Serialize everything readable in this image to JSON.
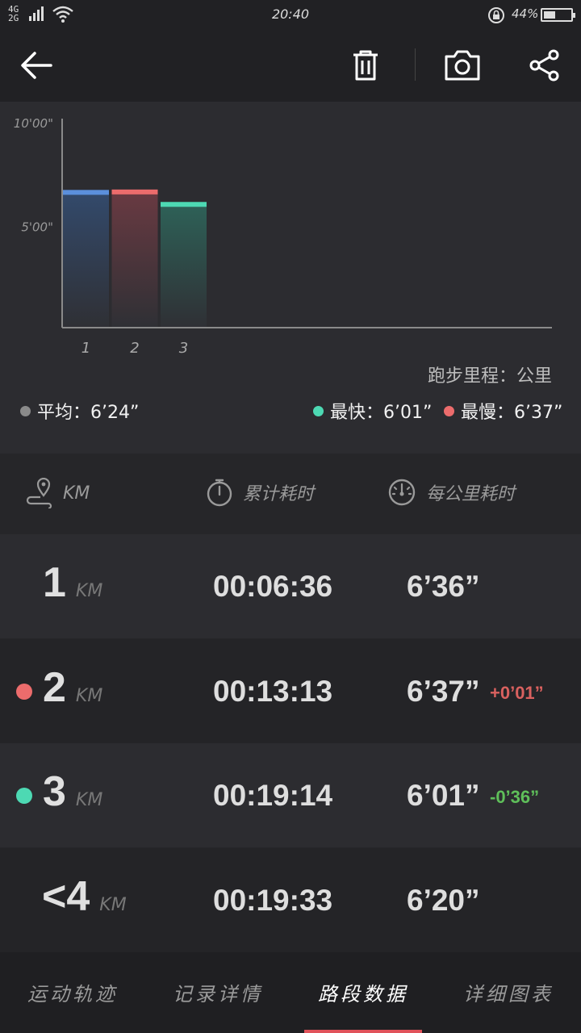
{
  "status_bar": {
    "network": [
      "4G",
      "2G"
    ],
    "time": "20:40",
    "battery_percent": "44%",
    "battery_level": 0.44
  },
  "toolbar": {
    "icons": [
      "back-arrow-icon",
      "trash-icon",
      "camera-icon",
      "share-icon"
    ]
  },
  "chart_data": {
    "type": "bar",
    "categories": [
      "1",
      "2",
      "3"
    ],
    "values": [
      6.6,
      6.62,
      6.02
    ],
    "bar_colors": [
      "#5b8fdc",
      "#ec6c6c",
      "#4dd9b3"
    ],
    "bar_fill_colors": [
      "#334a6c",
      "#6a3a42",
      "#2e6258"
    ],
    "ytick_labels": [
      "10'00\"",
      "5'00\""
    ],
    "ytick_values": [
      10,
      5
    ],
    "ylim": [
      0,
      10
    ],
    "x_slots": 10,
    "grid": false
  },
  "chart": {
    "unit_label": "跑步里程：公里",
    "avg_label": "平均：6’24”",
    "fast_label": "最快：6’01”",
    "slow_label": "最慢：6’37”",
    "colors": {
      "avg": "#8a8a8a",
      "fast": "#4dd9b3",
      "slow": "#ec6c6c"
    }
  },
  "table": {
    "headers": {
      "km": "KM",
      "cumulative": "累计耗时",
      "per_km": "每公里耗时"
    },
    "rows": [
      {
        "km": "1",
        "unit": "KM",
        "cumulative": "00:06:36",
        "pace": "6’36”",
        "diff": "",
        "mark": ""
      },
      {
        "km": "2",
        "unit": "KM",
        "cumulative": "00:13:13",
        "pace": "6’37”",
        "diff": "+0’01”",
        "mark": "#ec6c6c"
      },
      {
        "km": "3",
        "unit": "KM",
        "cumulative": "00:19:14",
        "pace": "6’01”",
        "diff": "-0’36”",
        "mark": "#4dd9b3"
      },
      {
        "km": "<4",
        "unit": "KM",
        "cumulative": "00:19:33",
        "pace": "6’20”",
        "diff": "",
        "mark": ""
      }
    ],
    "colors": {
      "diff_plus": "#d9615f",
      "diff_minus": "#5fbf5a"
    }
  },
  "tabs": [
    {
      "label": "运动轨迹",
      "active": false
    },
    {
      "label": "记录详情",
      "active": false
    },
    {
      "label": "路段数据",
      "active": true
    },
    {
      "label": "详细图表",
      "active": false
    }
  ]
}
